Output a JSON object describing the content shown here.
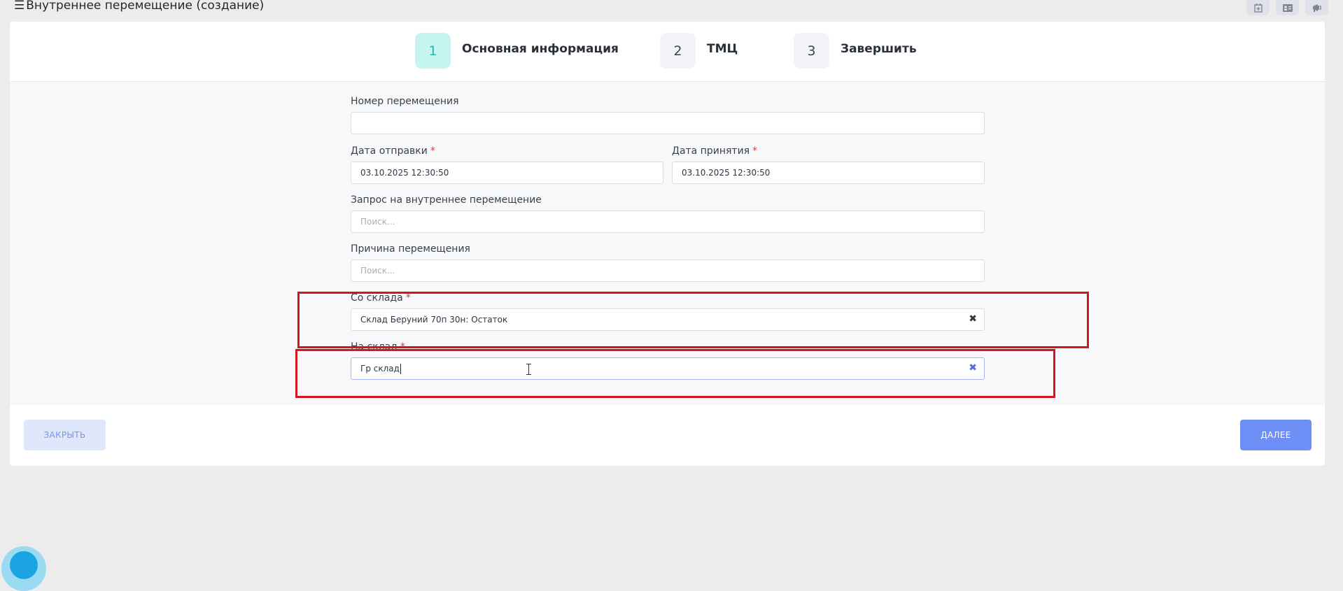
{
  "header": {
    "title": "Внутреннее перемещение (создание)",
    "menu_icon": "☰",
    "icons": [
      "calendar-plus-icon",
      "id-card-icon",
      "megaphone-icon"
    ]
  },
  "stepper": {
    "steps": [
      {
        "num": "1",
        "label": "Основная информация",
        "active": true
      },
      {
        "num": "2",
        "label": "ТМЦ",
        "active": false
      },
      {
        "num": "3",
        "label": "Завершить",
        "active": false
      }
    ]
  },
  "form": {
    "transfer_number": {
      "label": "Номер перемещения",
      "value": ""
    },
    "send_date": {
      "label": "Дата отправки",
      "required_mark": "*",
      "value": "03.10.2025 12:30:50"
    },
    "receive_date": {
      "label": "Дата принятия",
      "required_mark": "*",
      "value": "03.10.2025 12:30:50"
    },
    "request": {
      "label": "Запрос на внутреннее перемещение",
      "placeholder": "Поиск..."
    },
    "reason": {
      "label": "Причина перемещения",
      "placeholder": "Поиск..."
    },
    "from_warehouse": {
      "label": "Со склада",
      "required_mark": "*",
      "value": "Склад Беруний 70п 30н: Остаток",
      "clear": "✖"
    },
    "to_warehouse": {
      "label": "На склад",
      "required_mark": "*",
      "value": "Гр склад",
      "clear": "✖"
    }
  },
  "footer": {
    "close_label": "ЗАКРЫТЬ",
    "next_label": "ДАЛЕЕ"
  },
  "colors": {
    "accent": "#6d8ff6",
    "active_step": "#c6f4f1",
    "highlight": "#d2181e",
    "required": "#e53935"
  }
}
